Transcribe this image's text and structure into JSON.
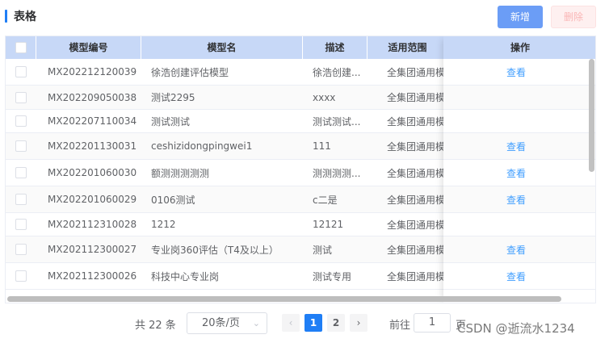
{
  "header": {
    "title": "表格",
    "add_label": "新增",
    "delete_label": "删除"
  },
  "table": {
    "columns": [
      "",
      "模型编号",
      "模型名",
      "描述",
      "适用范围",
      "操作"
    ],
    "rows": [
      {
        "code": "MX202212120039",
        "name": "徐浩创建评估模型",
        "desc": "徐浩创建...",
        "scope": "全集团通用模",
        "action": "查看"
      },
      {
        "code": "MX202209050038",
        "name": "测试2295",
        "desc": "xxxx",
        "scope": "全集团通用模",
        "action": ""
      },
      {
        "code": "MX202207110034",
        "name": "测试测试",
        "desc": "测试测试...",
        "scope": "全集团通用模",
        "action": ""
      },
      {
        "code": "MX202201130031",
        "name": "ceshizidongpingwei1",
        "desc": "111",
        "scope": "全集团通用模",
        "action": "查看"
      },
      {
        "code": "MX202201060030",
        "name": "额测测测测测",
        "desc": "测测测测...",
        "scope": "全集团通用模",
        "action": "查看"
      },
      {
        "code": "MX202201060029",
        "name": "0106测试",
        "desc": "c二是",
        "scope": "全集团通用模",
        "action": "查看"
      },
      {
        "code": "MX202112310028",
        "name": "1212",
        "desc": "12121",
        "scope": "全集团通用模",
        "action": ""
      },
      {
        "code": "MX202112300027",
        "name": "专业岗360评估（T4及以上）",
        "desc": "测试",
        "scope": "全集团通用模",
        "action": "查看"
      },
      {
        "code": "MX202112300026",
        "name": "科技中心专业岗",
        "desc": "测试专用",
        "scope": "全集团通用模",
        "action": "查看"
      }
    ]
  },
  "pagination": {
    "total_text": "共 22 条",
    "page_size": "20条/页",
    "prev": "‹",
    "next": "›",
    "pages": [
      "1",
      "2"
    ],
    "goto_label": "前往",
    "goto_value": "1",
    "goto_suffix": "页"
  },
  "watermark": "CSDN @逝流水1234"
}
